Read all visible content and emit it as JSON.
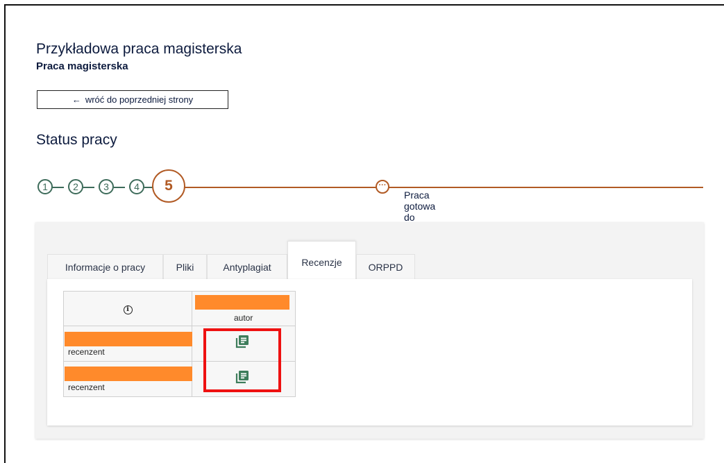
{
  "header": {
    "title": "Przykładowa praca magisterska",
    "subtitle": "Praca magisterska"
  },
  "back_button": {
    "arrow": "←",
    "label": "wróć do poprzedniej strony"
  },
  "status_section": {
    "title": "Status pracy"
  },
  "steps": [
    "1",
    "2",
    "3",
    "4"
  ],
  "current_step": "5",
  "status": {
    "icon": "more-dots-icon",
    "label": "Praca gotowa do obrony"
  },
  "tabs": [
    {
      "label": "Informacje o pracy"
    },
    {
      "label": "Pliki"
    },
    {
      "label": "Antyplagiat"
    },
    {
      "label": "Recenzje"
    },
    {
      "label": "ORPPD"
    }
  ],
  "active_tab": "Recenzje",
  "reviews_table": {
    "header": {
      "info_icon": "info-icon",
      "author_role": "autor"
    },
    "rows": [
      {
        "role": "recenzent",
        "action_icon": "review-document-icon"
      },
      {
        "role": "recenzent",
        "action_icon": "review-document-icon"
      }
    ]
  },
  "colors": {
    "step_done": "#3d6b5a",
    "step_current": "#b15a24",
    "redaction": "#ff8a2b",
    "highlight": "#ee1111",
    "doc_icon": "#3d7d5b"
  }
}
